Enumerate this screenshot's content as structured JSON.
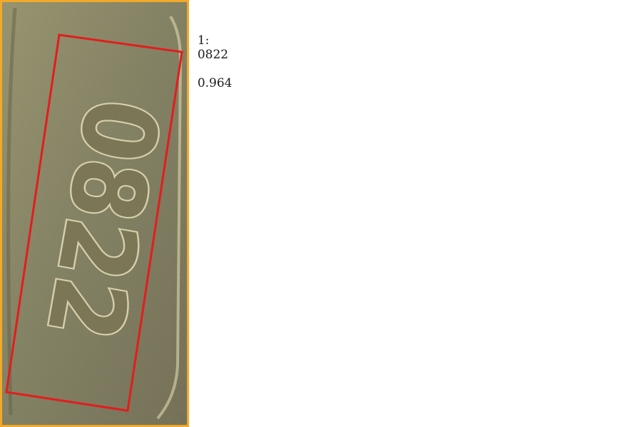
{
  "ocr_result": {
    "index": "1:",
    "text": "0822",
    "score": "0.964",
    "bbox_color": "#e31d1d",
    "panel_border_color": "#f2a92a"
  },
  "image_content": {
    "engraved_text": "0822",
    "engraved_text_orientation": "rotated 90 degrees"
  }
}
